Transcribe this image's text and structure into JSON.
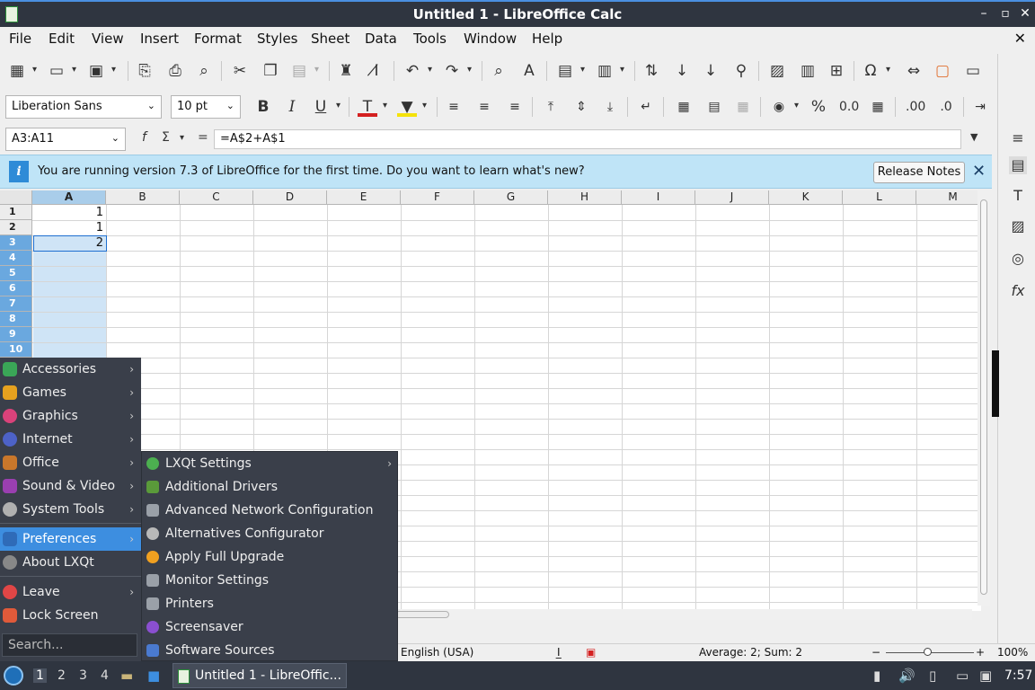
{
  "window": {
    "title": "Untitled 1 - LibreOffice Calc",
    "buttons": [
      "–",
      "▫",
      "✕"
    ]
  },
  "menubar": {
    "items": [
      "File",
      "Edit",
      "View",
      "Insert",
      "Format",
      "Styles",
      "Sheet",
      "Data",
      "Tools",
      "Window",
      "Help"
    ],
    "close": "✕"
  },
  "toolbar2": {
    "font_name": "Liberation Sans",
    "font_size": "10 pt"
  },
  "formula": {
    "name_box": "A3:A11",
    "fx": "f",
    "sigma": "Σ",
    "equals": "=",
    "content": "=A$2+A$1"
  },
  "infobar": {
    "message": "You are running version 7.3 of LibreOffice for the first time. Do you want to learn what's new?",
    "button": "Release Notes",
    "icon": "i"
  },
  "sheet": {
    "columns": [
      "A",
      "B",
      "C",
      "D",
      "E",
      "F",
      "G",
      "H",
      "I",
      "J",
      "K",
      "L",
      "M"
    ],
    "rows": [
      "1",
      "2",
      "3",
      "4",
      "5",
      "6",
      "7",
      "8",
      "9",
      "10"
    ],
    "cells": {
      "A1": "1",
      "A2": "1",
      "A3": "2"
    }
  },
  "statusbar": {
    "language": "English (USA)",
    "summary": "Average: 2; Sum: 2",
    "zoom": "100%"
  },
  "start_menu": {
    "items": [
      {
        "label": "Accessories",
        "arrow": "›",
        "color": "#3aa657"
      },
      {
        "label": "Games",
        "arrow": "›",
        "color": "#e6a11f"
      },
      {
        "label": "Graphics",
        "arrow": "›",
        "color": "#d9427a"
      },
      {
        "label": "Internet",
        "arrow": "›",
        "color": "#4d62c7"
      },
      {
        "label": "Office",
        "arrow": "›",
        "color": "#c9772b"
      },
      {
        "label": "Sound & Video",
        "arrow": "›",
        "color": "#9a3fb0"
      },
      {
        "label": "System Tools",
        "arrow": "›",
        "color": "#b0b0b0"
      },
      {
        "label": "Preferences",
        "arrow": "›",
        "color": "#3d8ee0"
      },
      {
        "label": "About LXQt",
        "arrow": "",
        "color": "#888888"
      },
      {
        "label": "Leave",
        "arrow": "›",
        "color": "#e04646"
      },
      {
        "label": "Lock Screen",
        "arrow": "",
        "color": "#e05a3a"
      }
    ],
    "search_placeholder": "Search...",
    "submenu": [
      {
        "label": "LXQt Settings",
        "arrow": "›",
        "color": "#4caf50"
      },
      {
        "label": "Additional Drivers",
        "arrow": "",
        "color": "#5a9a3a"
      },
      {
        "label": "Advanced Network Configuration",
        "arrow": "",
        "color": "#9aa0a8"
      },
      {
        "label": "Alternatives Configurator",
        "arrow": "",
        "color": "#b8b8b8"
      },
      {
        "label": "Apply Full Upgrade",
        "arrow": "",
        "color": "#f0a020"
      },
      {
        "label": "Monitor Settings",
        "arrow": "",
        "color": "#9aa0a8"
      },
      {
        "label": "Printers",
        "arrow": "",
        "color": "#9aa0a8"
      },
      {
        "label": "Screensaver",
        "arrow": "",
        "color": "#8a4fd0"
      },
      {
        "label": "Software Sources",
        "arrow": "",
        "color": "#4a7ad0"
      }
    ]
  },
  "taskbar": {
    "desktops": [
      "1",
      "2",
      "3",
      "4"
    ],
    "task_title": "Untitled 1 - LibreOffic...",
    "clock": "7:57"
  }
}
